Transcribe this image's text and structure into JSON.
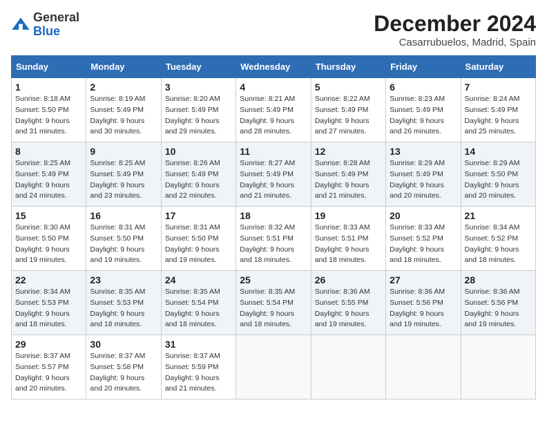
{
  "header": {
    "logo_general": "General",
    "logo_blue": "Blue",
    "month_title": "December 2024",
    "location": "Casarrubuelos, Madrid, Spain"
  },
  "weekdays": [
    "Sunday",
    "Monday",
    "Tuesday",
    "Wednesday",
    "Thursday",
    "Friday",
    "Saturday"
  ],
  "weeks": [
    [
      {
        "day": "1",
        "sunrise": "8:18 AM",
        "sunset": "5:50 PM",
        "daylight": "9 hours and 31 minutes."
      },
      {
        "day": "2",
        "sunrise": "8:19 AM",
        "sunset": "5:49 PM",
        "daylight": "9 hours and 30 minutes."
      },
      {
        "day": "3",
        "sunrise": "8:20 AM",
        "sunset": "5:49 PM",
        "daylight": "9 hours and 29 minutes."
      },
      {
        "day": "4",
        "sunrise": "8:21 AM",
        "sunset": "5:49 PM",
        "daylight": "9 hours and 28 minutes."
      },
      {
        "day": "5",
        "sunrise": "8:22 AM",
        "sunset": "5:49 PM",
        "daylight": "9 hours and 27 minutes."
      },
      {
        "day": "6",
        "sunrise": "8:23 AM",
        "sunset": "5:49 PM",
        "daylight": "9 hours and 26 minutes."
      },
      {
        "day": "7",
        "sunrise": "8:24 AM",
        "sunset": "5:49 PM",
        "daylight": "9 hours and 25 minutes."
      }
    ],
    [
      {
        "day": "8",
        "sunrise": "8:25 AM",
        "sunset": "5:49 PM",
        "daylight": "9 hours and 24 minutes."
      },
      {
        "day": "9",
        "sunrise": "8:25 AM",
        "sunset": "5:49 PM",
        "daylight": "9 hours and 23 minutes."
      },
      {
        "day": "10",
        "sunrise": "8:26 AM",
        "sunset": "5:49 PM",
        "daylight": "9 hours and 22 minutes."
      },
      {
        "day": "11",
        "sunrise": "8:27 AM",
        "sunset": "5:49 PM",
        "daylight": "9 hours and 21 minutes."
      },
      {
        "day": "12",
        "sunrise": "8:28 AM",
        "sunset": "5:49 PM",
        "daylight": "9 hours and 21 minutes."
      },
      {
        "day": "13",
        "sunrise": "8:29 AM",
        "sunset": "5:49 PM",
        "daylight": "9 hours and 20 minutes."
      },
      {
        "day": "14",
        "sunrise": "8:29 AM",
        "sunset": "5:50 PM",
        "daylight": "9 hours and 20 minutes."
      }
    ],
    [
      {
        "day": "15",
        "sunrise": "8:30 AM",
        "sunset": "5:50 PM",
        "daylight": "9 hours and 19 minutes."
      },
      {
        "day": "16",
        "sunrise": "8:31 AM",
        "sunset": "5:50 PM",
        "daylight": "9 hours and 19 minutes."
      },
      {
        "day": "17",
        "sunrise": "8:31 AM",
        "sunset": "5:50 PM",
        "daylight": "9 hours and 19 minutes."
      },
      {
        "day": "18",
        "sunrise": "8:32 AM",
        "sunset": "5:51 PM",
        "daylight": "9 hours and 18 minutes."
      },
      {
        "day": "19",
        "sunrise": "8:33 AM",
        "sunset": "5:51 PM",
        "daylight": "9 hours and 18 minutes."
      },
      {
        "day": "20",
        "sunrise": "8:33 AM",
        "sunset": "5:52 PM",
        "daylight": "9 hours and 18 minutes."
      },
      {
        "day": "21",
        "sunrise": "8:34 AM",
        "sunset": "5:52 PM",
        "daylight": "9 hours and 18 minutes."
      }
    ],
    [
      {
        "day": "22",
        "sunrise": "8:34 AM",
        "sunset": "5:53 PM",
        "daylight": "9 hours and 18 minutes."
      },
      {
        "day": "23",
        "sunrise": "8:35 AM",
        "sunset": "5:53 PM",
        "daylight": "9 hours and 18 minutes."
      },
      {
        "day": "24",
        "sunrise": "8:35 AM",
        "sunset": "5:54 PM",
        "daylight": "9 hours and 18 minutes."
      },
      {
        "day": "25",
        "sunrise": "8:35 AM",
        "sunset": "5:54 PM",
        "daylight": "9 hours and 18 minutes."
      },
      {
        "day": "26",
        "sunrise": "8:36 AM",
        "sunset": "5:55 PM",
        "daylight": "9 hours and 19 minutes."
      },
      {
        "day": "27",
        "sunrise": "8:36 AM",
        "sunset": "5:56 PM",
        "daylight": "9 hours and 19 minutes."
      },
      {
        "day": "28",
        "sunrise": "8:36 AM",
        "sunset": "5:56 PM",
        "daylight": "9 hours and 19 minutes."
      }
    ],
    [
      {
        "day": "29",
        "sunrise": "8:37 AM",
        "sunset": "5:57 PM",
        "daylight": "9 hours and 20 minutes."
      },
      {
        "day": "30",
        "sunrise": "8:37 AM",
        "sunset": "5:58 PM",
        "daylight": "9 hours and 20 minutes."
      },
      {
        "day": "31",
        "sunrise": "8:37 AM",
        "sunset": "5:59 PM",
        "daylight": "9 hours and 21 minutes."
      },
      null,
      null,
      null,
      null
    ]
  ]
}
